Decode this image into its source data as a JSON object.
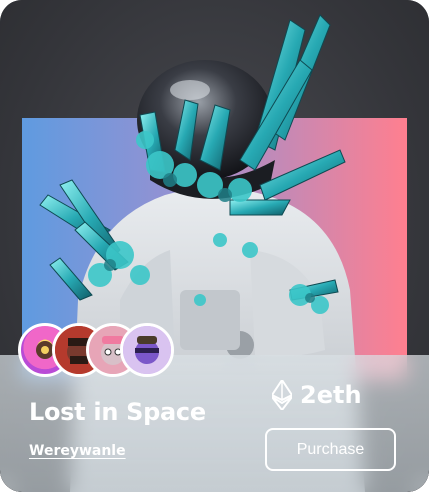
{
  "nft": {
    "title": "Lost in Space",
    "creator": "Wereywanle",
    "price": "2eth",
    "purchase_label": "Purchase"
  },
  "avatars": [
    {
      "name": "avatar-1",
      "colors": [
        "#f067c8",
        "#b94bd6"
      ]
    },
    {
      "name": "avatar-2",
      "colors": [
        "#7a3a2e",
        "#c0392b"
      ]
    },
    {
      "name": "avatar-3",
      "colors": [
        "#e7a5b7",
        "#d8c0c8"
      ]
    },
    {
      "name": "avatar-4",
      "colors": [
        "#c9a7e6",
        "#7b57c9"
      ]
    }
  ],
  "icons": {
    "currency": "ethereum-icon"
  },
  "colors": {
    "card_bg": "#3a3b40",
    "gradient_left": "#5f9be0",
    "gradient_right": "#ff7f8f",
    "crystal": "#2fb7bd",
    "text": "#ffffff"
  }
}
